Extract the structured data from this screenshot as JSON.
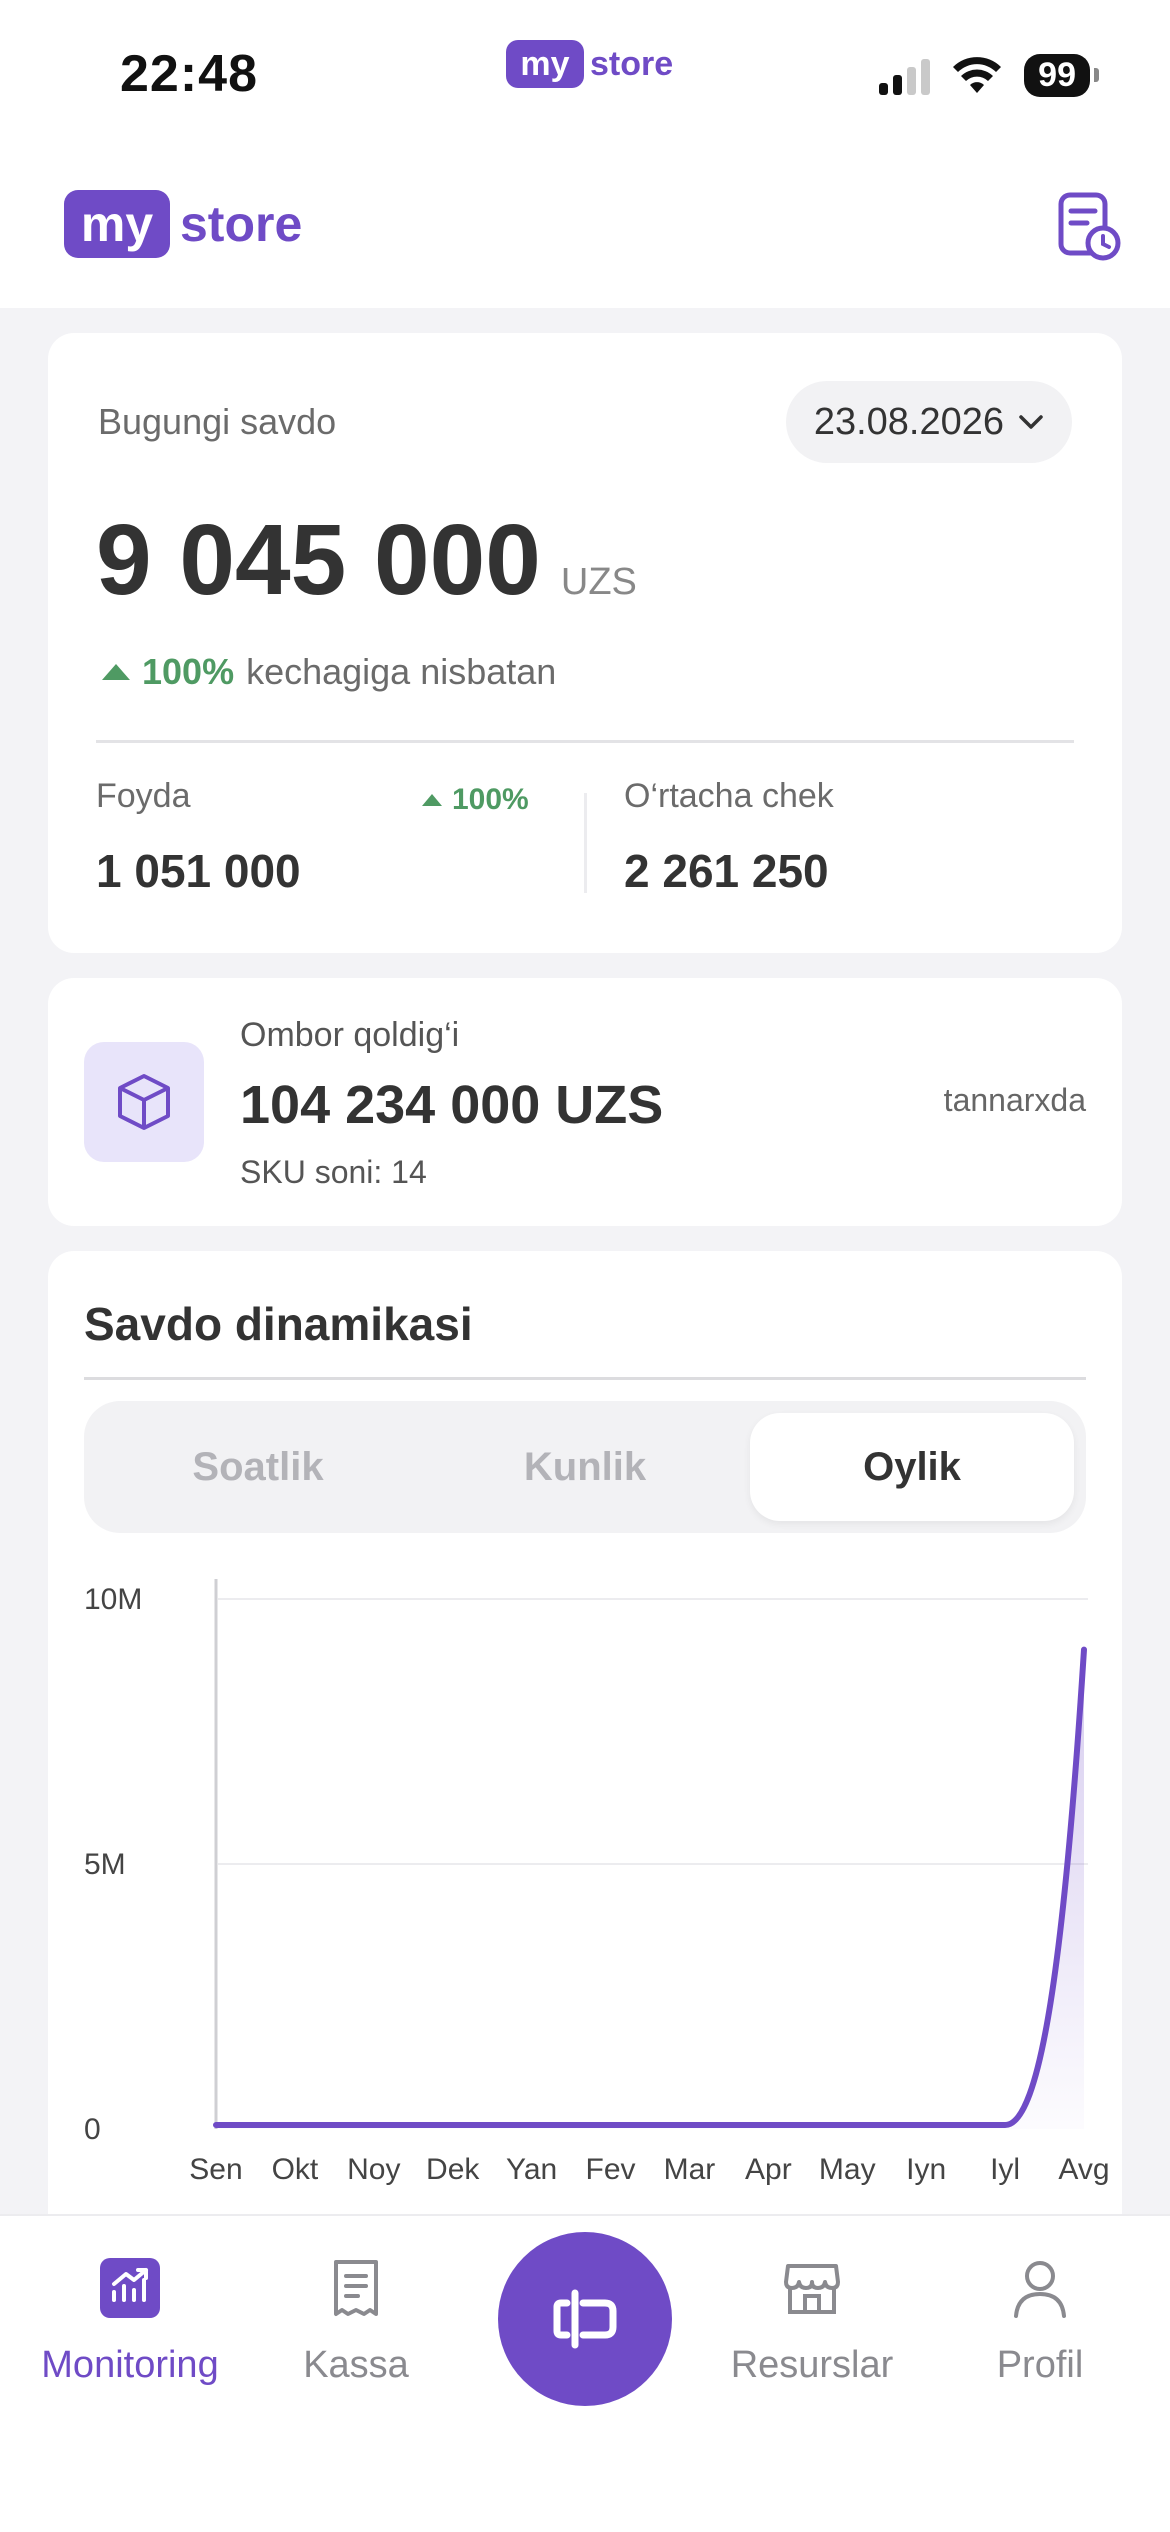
{
  "status_bar": {
    "time": "22:48",
    "center_logo": {
      "pill": "my",
      "text": "store"
    },
    "battery": "99",
    "icons": [
      "cellular-signal-icon",
      "wifi-icon",
      "battery-icon"
    ]
  },
  "header": {
    "logo": {
      "pill": "my",
      "text": "store"
    },
    "report_icon": "report-clock-icon"
  },
  "sales": {
    "label": "Bugungi savdo",
    "date": "23.08.2026",
    "amount": "9 045 000",
    "currency": "UZS",
    "trend_percent": "100%",
    "trend_text": "kechagiga nisbatan",
    "profit_label": "Foyda",
    "profit_trend": "100%",
    "profit_value": "1 051 000",
    "avg_label": "O‘rtacha chek",
    "avg_value": "2 261 250"
  },
  "stock": {
    "title": "Ombor qoldig‘i",
    "value": "104 234 000 UZS",
    "sku": "SKU soni: 14",
    "note": "tannarxda",
    "icon": "box-icon"
  },
  "chart_section": {
    "title": "Savdo dinamikasi",
    "tabs": [
      "Soatlik",
      "Kunlik",
      "Oylik"
    ],
    "active_tab": 2
  },
  "chart_data": {
    "type": "area",
    "categories": [
      "Sen",
      "Okt",
      "Noy",
      "Dek",
      "Yan",
      "Fev",
      "Mar",
      "Apr",
      "May",
      "Iyn",
      "Iyl",
      "Avg"
    ],
    "values": [
      0,
      0,
      0,
      0,
      0,
      0,
      0,
      0,
      0,
      0,
      0,
      9045000
    ],
    "ylim": [
      0,
      10000000
    ],
    "yticks": [
      0,
      5000000,
      10000000
    ],
    "ytick_labels": [
      "0",
      "5M",
      "10M"
    ],
    "grid": true,
    "color": "#6f4bc6"
  },
  "nav": {
    "items": [
      {
        "label": "Monitoring",
        "icon": "chart-up-icon",
        "active": true
      },
      {
        "label": "Kassa",
        "icon": "receipt-icon",
        "active": false
      },
      {
        "label": "Resurslar",
        "icon": "store-icon",
        "active": false
      },
      {
        "label": "Profil",
        "icon": "user-icon",
        "active": false
      }
    ],
    "center_icon": "cash-register-icon"
  },
  "colors": {
    "accent": "#6f4bc6",
    "positive": "#4f9a63"
  }
}
